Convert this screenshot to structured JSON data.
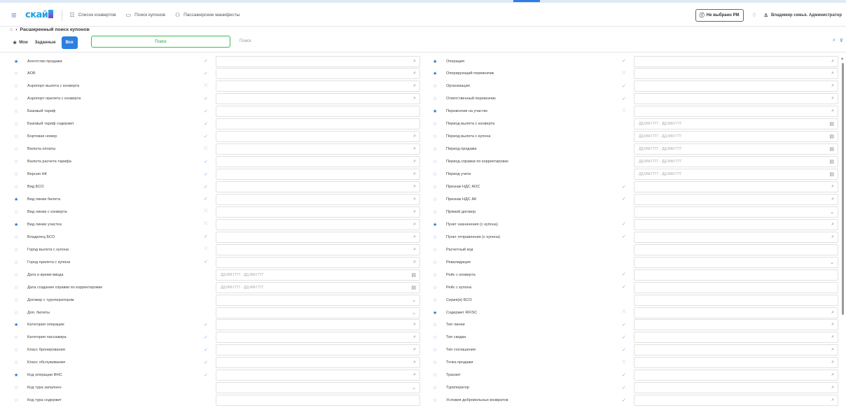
{
  "navbar": {
    "logo": "скай",
    "links": [
      {
        "label": "Список конвертов",
        "icon": "list-icon",
        "glyph": "☷"
      },
      {
        "label": "Поиск купонов",
        "icon": "window-icon",
        "glyph": "▭"
      },
      {
        "label": "Пассажирские манифесты",
        "icon": "people-icon",
        "glyph": "⚇"
      }
    ],
    "rm_label": "Не выбрано РМ",
    "user_label": "Владимир семья. Администратор"
  },
  "breadcrumb": {
    "title": "Расширенный поиск купонов"
  },
  "toolbar": {
    "mine": "Мои",
    "assigned": "Заданные",
    "all": "Все",
    "search_label": "Поиск",
    "search_placeholder": "Поиск"
  },
  "date_placeholder": "ДД.ММ.ГГГГ - ДД.ММ.ГГГГ",
  "left_rows": [
    {
      "label": "Агентство продажи",
      "fav": true,
      "mark": "check",
      "field": "search"
    },
    {
      "label": "АОБ",
      "fav": false,
      "mark": "check",
      "field": "search"
    },
    {
      "label": "Аэропорт вылета с конверта",
      "fav": false,
      "mark": "cross",
      "field": "search"
    },
    {
      "label": "Аэропорт прилета с конверта",
      "fav": false,
      "mark": "check",
      "field": "search"
    },
    {
      "label": "Базовый тариф",
      "fav": false,
      "mark": "check",
      "field": "text"
    },
    {
      "label": "Базовый тариф содержит",
      "fav": false,
      "mark": "check",
      "field": "text"
    },
    {
      "label": "Бортовая номер",
      "fav": false,
      "mark": "check",
      "field": "search"
    },
    {
      "label": "Валюта оплаты",
      "fav": false,
      "mark": "cross",
      "field": "search"
    },
    {
      "label": "Валюта расчета тарифа",
      "fav": false,
      "mark": "check",
      "field": "search"
    },
    {
      "label": "Версия НК",
      "fav": false,
      "mark": "check",
      "field": "search"
    },
    {
      "label": "Вид БСО",
      "fav": false,
      "mark": "check",
      "field": "search"
    },
    {
      "label": "Вид линии билета",
      "fav": true,
      "mark": "check",
      "field": "search"
    },
    {
      "label": "Вид линии с конверта",
      "fav": false,
      "mark": "cross",
      "field": "search"
    },
    {
      "label": "Вид линии участка",
      "fav": true,
      "mark": "cross",
      "field": "search"
    },
    {
      "label": "Владелец БСО",
      "fav": false,
      "mark": "check",
      "field": "search"
    },
    {
      "label": "Город вылета с купона",
      "fav": false,
      "mark": "cross",
      "field": "search"
    },
    {
      "label": "Город прилета с купона",
      "fav": false,
      "mark": "check",
      "field": "search"
    },
    {
      "label": "Дата и время ввода",
      "fav": false,
      "mark": "",
      "field": "date"
    },
    {
      "label": "Дата создания справки по корректировке",
      "fav": false,
      "mark": "",
      "field": "date"
    },
    {
      "label": "Договор с туроператором",
      "fav": false,
      "mark": "",
      "field": "select"
    },
    {
      "label": "Доп. билеты",
      "fav": false,
      "mark": "",
      "field": "select"
    },
    {
      "label": "Категория операции",
      "fav": true,
      "mark": "check",
      "field": "search"
    },
    {
      "label": "Категория пассажира",
      "fav": false,
      "mark": "check",
      "field": "search"
    },
    {
      "label": "Класс бронирования",
      "fav": false,
      "mark": "check",
      "field": "search"
    },
    {
      "label": "Класс обслуживания",
      "fav": false,
      "mark": "check",
      "field": "search"
    },
    {
      "label": "Код операции ФНС",
      "fav": true,
      "mark": "check",
      "field": "search"
    },
    {
      "label": "Код тура запалнен",
      "fav": false,
      "mark": "",
      "field": "select"
    },
    {
      "label": "Код тура содержит",
      "fav": false,
      "mark": "",
      "field": "text"
    }
  ],
  "right_rows": [
    {
      "label": "Операция",
      "fav": true,
      "mark": "check",
      "field": "search"
    },
    {
      "label": "Оперирующий перевозчик",
      "fav": true,
      "mark": "cross",
      "field": "search"
    },
    {
      "label": "Организация",
      "fav": false,
      "mark": "check",
      "field": "search"
    },
    {
      "label": "Ответственный перевозчик",
      "fav": false,
      "mark": "check",
      "field": "search"
    },
    {
      "label": "Перевозчик на участке",
      "fav": true,
      "mark": "cross",
      "field": "search"
    },
    {
      "label": "Период вылета с конверта",
      "fav": false,
      "mark": "",
      "field": "date"
    },
    {
      "label": "Период вылета с купона",
      "fav": false,
      "mark": "",
      "field": "date"
    },
    {
      "label": "Период продажи",
      "fav": false,
      "mark": "",
      "field": "date"
    },
    {
      "label": "Период справки по корректировке",
      "fav": false,
      "mark": "",
      "field": "date"
    },
    {
      "label": "Период учета",
      "fav": false,
      "mark": "",
      "field": "date"
    },
    {
      "label": "Признак НДС АОС",
      "fav": false,
      "mark": "check",
      "field": "search"
    },
    {
      "label": "Признак НДС АК",
      "fav": false,
      "mark": "check",
      "field": "search"
    },
    {
      "label": "Прямой договор",
      "fav": false,
      "mark": "",
      "field": "select"
    },
    {
      "label": "Пункт назначения (с купона)",
      "fav": true,
      "mark": "check",
      "field": "search"
    },
    {
      "label": "Пункт отправления (с купона)",
      "fav": false,
      "mark": "check",
      "field": "search"
    },
    {
      "label": "Расчетный код",
      "fav": false,
      "mark": "",
      "field": "text"
    },
    {
      "label": "Ревалидация",
      "fav": false,
      "mark": "",
      "field": "select"
    },
    {
      "label": "Рейс с конверта",
      "fav": false,
      "mark": "check",
      "field": "text"
    },
    {
      "label": "Рейс с купона",
      "fav": false,
      "mark": "check",
      "field": "text"
    },
    {
      "label": "Серия(и) БСО",
      "fav": false,
      "mark": "",
      "field": "text"
    },
    {
      "label": "Содержит RFISC",
      "fav": true,
      "mark": "cross",
      "field": "search"
    },
    {
      "label": "Тип линии",
      "fav": false,
      "mark": "check",
      "field": "search"
    },
    {
      "label": "Тип скидки",
      "fav": false,
      "mark": "check",
      "field": "search"
    },
    {
      "label": "Тип соглашения",
      "fav": false,
      "mark": "check",
      "field": "search"
    },
    {
      "label": "Точка продажи",
      "fav": false,
      "mark": "cross",
      "field": "search"
    },
    {
      "label": "Транзит",
      "fav": false,
      "mark": "check",
      "field": "search"
    },
    {
      "label": "Туроператор",
      "fav": false,
      "mark": "check",
      "field": "search"
    },
    {
      "label": "Условия добровольных возвратов",
      "fav": false,
      "mark": "check",
      "field": "search"
    }
  ]
}
